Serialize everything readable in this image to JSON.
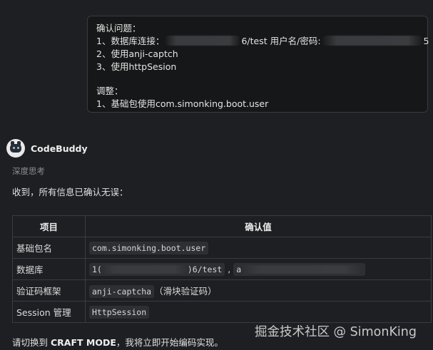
{
  "user_message": {
    "title": "确认问题：",
    "line1_prefix": "1、数据库连接：",
    "line1_mid": "6/test  用户名/密码:",
    "line1_end": "5",
    "line2": "2、使用anji-captch",
    "line3": "3、使用httpSesion",
    "adjust_title": "调整：",
    "adjust_line1": "1、基础包使用com.simonking.boot.user"
  },
  "assistant": {
    "name": "CodeBuddy",
    "thinking_label": "深度思考",
    "intro": "收到，所有信息已确认无误："
  },
  "table": {
    "headers": [
      "项目",
      "确认值"
    ],
    "rows": [
      {
        "key": "基础包名",
        "code": "com.simonking.boot.user",
        "suffix": ""
      },
      {
        "key": "数据库",
        "code_prefix": "1(",
        "code_mid": ")6/test",
        "sep": " , ",
        "code_tail": "a"
      },
      {
        "key": "验证码框架",
        "code": "anji-captcha",
        "suffix": "（滑块验证码）"
      },
      {
        "key": "Session 管理",
        "code": "HttpSession",
        "suffix": ""
      }
    ]
  },
  "footer": {
    "prefix": "请切换到 ",
    "mode": "CRAFT MODE",
    "suffix": "，我将立即开始编码实现。"
  },
  "watermark": "掘金技术社区 @ SimonKing",
  "colors": {
    "background": "#1e1f22",
    "bubble": "#161718",
    "border": "#3b3c40",
    "code_bg": "#2e2f33"
  }
}
